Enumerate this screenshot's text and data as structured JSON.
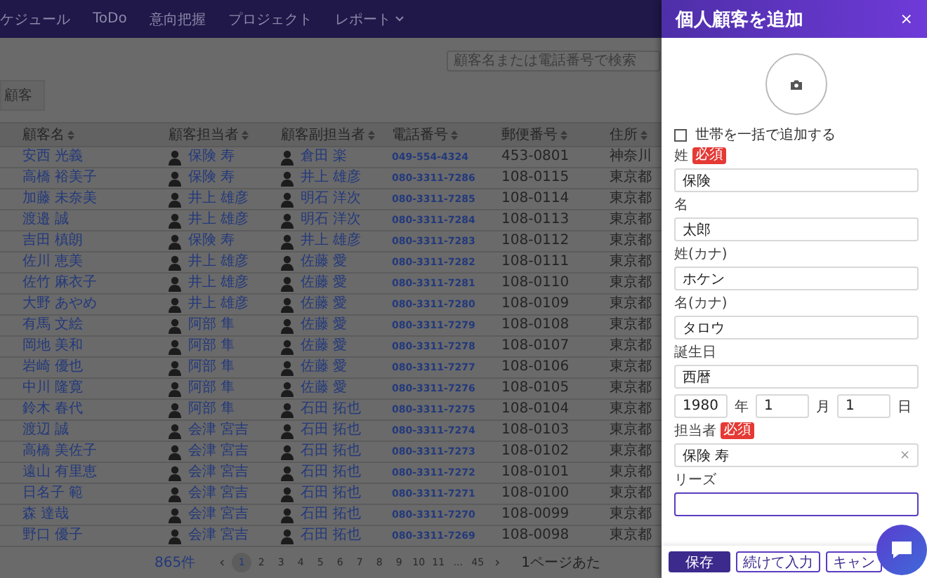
{
  "nav": {
    "items": [
      {
        "label": "ケジュール"
      },
      {
        "label": "ToDo"
      },
      {
        "label": "意向把握"
      },
      {
        "label": "プロジェクト"
      },
      {
        "label": "レポート",
        "dropdown": true
      }
    ]
  },
  "search": {
    "placeholder": "顧客名または電話番号で検索"
  },
  "filter": {
    "label": "顧客"
  },
  "table": {
    "columns": [
      "顧客名",
      "顧客担当者",
      "顧客副担当者",
      "電話番号",
      "郵便番号",
      "住所"
    ],
    "rows": [
      {
        "name": "安西 光義",
        "rep": "保険 寿",
        "sub_rep": "倉田 楽",
        "phone": "049-554-4324",
        "postal": "453-0801",
        "address": "神奈川"
      },
      {
        "name": "高橋 裕美子",
        "rep": "保険 寿",
        "sub_rep": "井上 雄彦",
        "phone": "080-3311-7286",
        "postal": "108-0115",
        "address": "東京都"
      },
      {
        "name": "加藤 未奈美",
        "rep": "井上 雄彦",
        "sub_rep": "明石 洋次",
        "phone": "080-3311-7285",
        "postal": "108-0114",
        "address": "東京都"
      },
      {
        "name": "渡邉 誠",
        "rep": "井上 雄彦",
        "sub_rep": "明石 洋次",
        "phone": "080-3311-7284",
        "postal": "108-0113",
        "address": "東京都"
      },
      {
        "name": "吉田 槙朗",
        "rep": "保険 寿",
        "sub_rep": "井上 雄彦",
        "phone": "080-3311-7283",
        "postal": "108-0112",
        "address": "東京都"
      },
      {
        "name": "佐川 恵美",
        "rep": "井上 雄彦",
        "sub_rep": "佐藤 愛",
        "phone": "080-3311-7282",
        "postal": "108-0111",
        "address": "東京都"
      },
      {
        "name": "佐竹 麻衣子",
        "rep": "井上 雄彦",
        "sub_rep": "佐藤 愛",
        "phone": "080-3311-7281",
        "postal": "108-0110",
        "address": "東京都"
      },
      {
        "name": "大野 あやめ",
        "rep": "井上 雄彦",
        "sub_rep": "佐藤 愛",
        "phone": "080-3311-7280",
        "postal": "108-0109",
        "address": "東京都"
      },
      {
        "name": "有馬 文絵",
        "rep": "阿部 隼",
        "sub_rep": "佐藤 愛",
        "phone": "080-3311-7279",
        "postal": "108-0108",
        "address": "東京都"
      },
      {
        "name": "岡地 美和",
        "rep": "阿部 隼",
        "sub_rep": "佐藤 愛",
        "phone": "080-3311-7278",
        "postal": "108-0107",
        "address": "東京都"
      },
      {
        "name": "岩崎 優也",
        "rep": "阿部 隼",
        "sub_rep": "佐藤 愛",
        "phone": "080-3311-7277",
        "postal": "108-0106",
        "address": "東京都"
      },
      {
        "name": "中川 隆寛",
        "rep": "阿部 隼",
        "sub_rep": "佐藤 愛",
        "phone": "080-3311-7276",
        "postal": "108-0105",
        "address": "東京都"
      },
      {
        "name": "鈴木 春代",
        "rep": "阿部 隼",
        "sub_rep": "石田 拓也",
        "phone": "080-3311-7275",
        "postal": "108-0104",
        "address": "東京都"
      },
      {
        "name": "渡辺 誠",
        "rep": "会津 宮吉",
        "sub_rep": "石田 拓也",
        "phone": "080-3311-7274",
        "postal": "108-0103",
        "address": "東京都"
      },
      {
        "name": "高橋 美佐子",
        "rep": "会津 宮吉",
        "sub_rep": "石田 拓也",
        "phone": "080-3311-7273",
        "postal": "108-0102",
        "address": "東京都"
      },
      {
        "name": "遠山 有里恵",
        "rep": "会津 宮吉",
        "sub_rep": "石田 拓也",
        "phone": "080-3311-7272",
        "postal": "108-0101",
        "address": "東京都"
      },
      {
        "name": "日名子 範",
        "rep": "会津 宮吉",
        "sub_rep": "石田 拓也",
        "phone": "080-3311-7271",
        "postal": "108-0100",
        "address": "東京都"
      },
      {
        "name": "森 達哉",
        "rep": "会津 宮吉",
        "sub_rep": "石田 拓也",
        "phone": "080-3311-7270",
        "postal": "108-0099",
        "address": "東京都"
      },
      {
        "name": "野口 優子",
        "rep": "会津 宮吉",
        "sub_rep": "石田 拓也",
        "phone": "080-3311-7269",
        "postal": "108-0098",
        "address": "東京都"
      }
    ]
  },
  "pagination": {
    "total": "865件",
    "prev": "‹",
    "pages": [
      {
        "label": "1",
        "selected": true
      },
      {
        "label": "2",
        "selected": false
      },
      {
        "label": "3",
        "selected": false
      },
      {
        "label": "4",
        "selected": false
      },
      {
        "label": "5",
        "selected": false
      },
      {
        "label": "6",
        "selected": false
      },
      {
        "label": "7",
        "selected": false
      },
      {
        "label": "8",
        "selected": false
      },
      {
        "label": "9",
        "selected": false
      },
      {
        "label": "10",
        "selected": false
      },
      {
        "label": "11",
        "selected": false
      },
      {
        "label": "...",
        "selected": false
      },
      {
        "label": "45",
        "selected": false
      }
    ],
    "next": "›",
    "per_page": "1ページあた"
  },
  "drawer": {
    "title": "個人顧客を追加",
    "close": "×",
    "household": {
      "label": "世帯を一括で追加する",
      "checked": false
    },
    "fields": [
      {
        "kind": "text",
        "label": "姓",
        "badge": "必須",
        "value": "保険",
        "focused": false
      },
      {
        "kind": "text",
        "label": "名",
        "value": "太郎",
        "focused": false
      },
      {
        "kind": "text",
        "label": "姓(カナ)",
        "value": "ホケン",
        "focused": false
      },
      {
        "kind": "text",
        "label": "名(カナ)",
        "value": "タロウ",
        "focused": false
      },
      {
        "kind": "date",
        "label": "誕生日",
        "value": "西暦",
        "parts": [
          {
            "value": "1980",
            "unit": "年"
          },
          {
            "value": "1",
            "unit": "月"
          },
          {
            "value": "1",
            "unit": "日"
          }
        ]
      },
      {
        "kind": "select",
        "label": "担当者",
        "badge": "必須",
        "value": "保険 寿",
        "clear": "×"
      },
      {
        "kind": "text",
        "label": "リーズ",
        "focused": true
      }
    ],
    "buttons": [
      {
        "label": "保存",
        "kind": "primary"
      },
      {
        "label": "続けて入力",
        "kind": "outline"
      },
      {
        "label": "キャン",
        "kind": "outline"
      }
    ]
  }
}
